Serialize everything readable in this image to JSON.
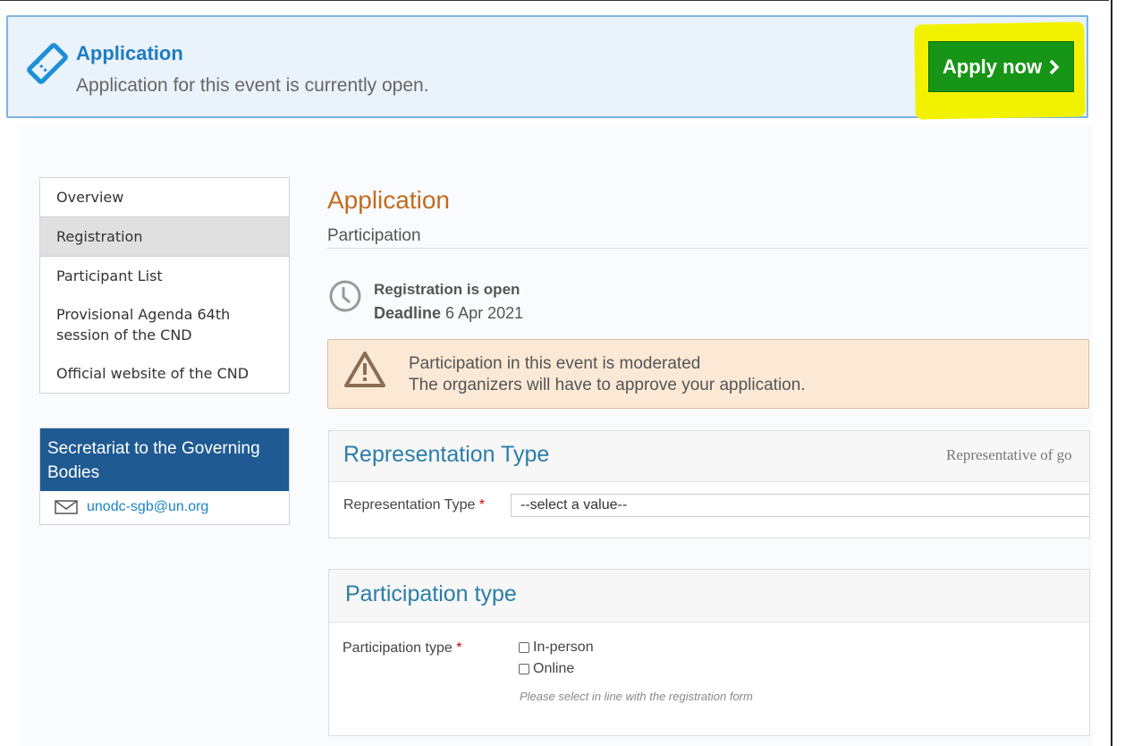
{
  "banner": {
    "title": "Application",
    "text": "Application for this event is currently open.",
    "button_label": "Apply now",
    "button_color": "#179517"
  },
  "sidebar": {
    "items": [
      {
        "label": "Overview"
      },
      {
        "label": "Registration"
      },
      {
        "label": "Participant List"
      },
      {
        "label": "Provisional Agenda 64th session of the CND"
      },
      {
        "label": "Official website of the CND"
      }
    ],
    "active_index": 1,
    "contact": {
      "heading": "Secretariat to the Governing Bodies",
      "email": "unodc-sgb@un.org"
    }
  },
  "main": {
    "title": "Application",
    "subtitle": "Participation",
    "registration_status": "Registration is open",
    "deadline_label": "Deadline",
    "deadline_value": "6 Apr 2021",
    "warning": {
      "line1": "Participation in this event is moderated",
      "line2": "The organizers will have to approve your application."
    },
    "representation": {
      "title": "Representation Type",
      "right_text": "Representative of go",
      "field_label": "Representation Type",
      "select_value": "--select a value--"
    },
    "participation": {
      "title": "Participation type",
      "field_label": "Participation type",
      "options": [
        "In-person",
        "Online"
      ],
      "help": "Please select in line with the registration form"
    }
  },
  "icons": {
    "banner": "ticket-icon",
    "clock": "clock-icon",
    "warning": "warning-icon",
    "email": "envelope-icon",
    "apply": "chevron-right-icon"
  },
  "colors": {
    "accent_blue": "#1d7cc3",
    "title_orange": "#c36c20",
    "contact_header": "#1f5a92",
    "warning_bg": "#fbe9d6",
    "highlight": "#f2f200"
  }
}
